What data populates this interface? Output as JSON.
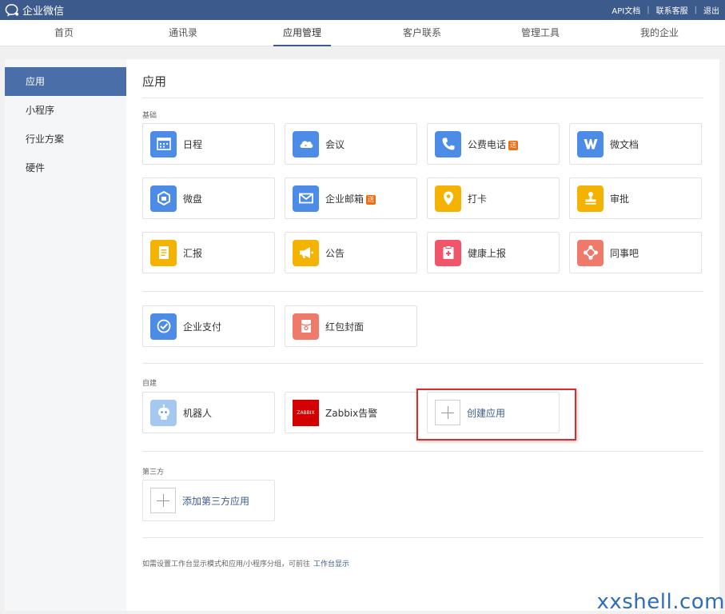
{
  "brand": {
    "name": "企业微信"
  },
  "top_links": [
    "API文档",
    "联系客服",
    "退出"
  ],
  "nav_tabs": [
    "首页",
    "通讯录",
    "应用管理",
    "客户联系",
    "管理工具",
    "我的企业"
  ],
  "active_nav": "应用管理",
  "sidebar": {
    "items": [
      "应用",
      "小程序",
      "行业方案",
      "硬件"
    ],
    "active": "应用"
  },
  "main": {
    "title": "应用",
    "sections": {
      "basic": {
        "label": "基础",
        "apps": [
          {
            "name": "日程",
            "icon": "calendar-icon",
            "color": "#4c8be6"
          },
          {
            "name": "会议",
            "icon": "cloud-meeting-icon",
            "color": "#4c8be6"
          },
          {
            "name": "公费电话",
            "icon": "phone-icon",
            "color": "#4c8be6",
            "badge": "送"
          },
          {
            "name": "微文档",
            "icon": "doc-w-icon",
            "color": "#4c8be6"
          },
          {
            "name": "微盘",
            "icon": "drive-icon",
            "color": "#4c8be6"
          },
          {
            "name": "企业邮箱",
            "icon": "mail-icon",
            "color": "#4c8be6",
            "badge": "送"
          },
          {
            "name": "打卡",
            "icon": "location-pin-icon",
            "color": "#f5b301"
          },
          {
            "name": "审批",
            "icon": "stamp-icon",
            "color": "#f5b301"
          },
          {
            "name": "汇报",
            "icon": "report-icon",
            "color": "#f5b301"
          },
          {
            "name": "公告",
            "icon": "megaphone-icon",
            "color": "#f5b301"
          },
          {
            "name": "健康上报",
            "icon": "health-clipboard-icon",
            "color": "#f0556a"
          },
          {
            "name": "同事吧",
            "icon": "network-icon",
            "color": "#f07a6a"
          }
        ]
      },
      "pay": {
        "apps": [
          {
            "name": "企业支付",
            "icon": "pay-check-icon",
            "color": "#4c8be6"
          },
          {
            "name": "红包封面",
            "icon": "red-envelope-icon",
            "color": "#f07a6a"
          }
        ]
      },
      "custom": {
        "label": "自建",
        "apps": [
          {
            "name": "机器人",
            "icon": "robot-icon",
            "color": "#a5c8f0"
          },
          {
            "name": "Zabbix告警",
            "icon": "zabbix-icon",
            "color": "#d40000",
            "icon_text": "ZABBIX"
          }
        ],
        "create_label": "创建应用"
      },
      "third": {
        "label": "第三方",
        "add_label": "添加第三方应用"
      }
    },
    "footnote": "如需设置工作台显示模式和应用/小程序分组，可前往",
    "footnote_link": "工作台显示"
  },
  "watermark": "xxshell.com"
}
